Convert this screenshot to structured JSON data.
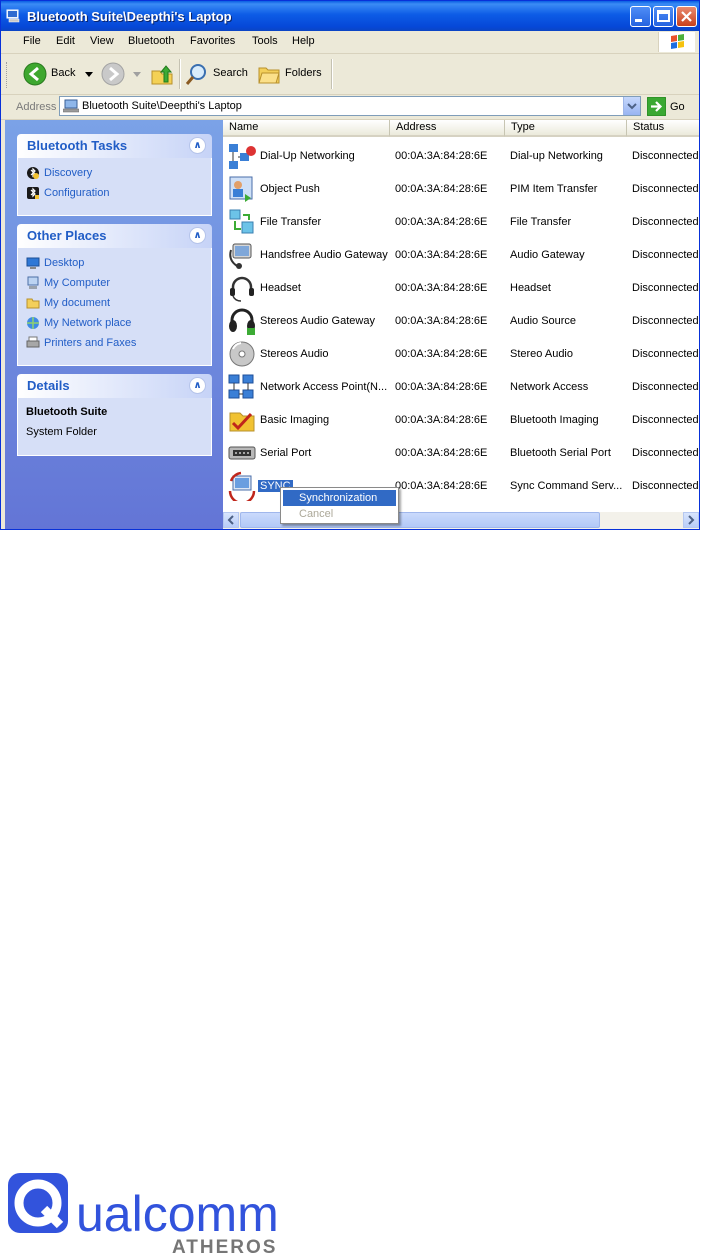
{
  "window": {
    "title": "Bluetooth Suite\\Deepthi's Laptop"
  },
  "menu": [
    "File",
    "Edit",
    "View",
    "Bluetooth",
    "Favorites",
    "Tools",
    "Help"
  ],
  "toolbar": {
    "back": "Back",
    "search": "Search",
    "folders": "Folders"
  },
  "address": {
    "label": "Address",
    "value": "Bluetooth Suite\\Deepthi's Laptop",
    "go": "Go"
  },
  "taskpane": {
    "bluetooth_tasks": {
      "title": "Bluetooth Tasks",
      "items": [
        "Discovery",
        "Configuration"
      ]
    },
    "other_places": {
      "title": "Other Places",
      "items": [
        "Desktop",
        "My Computer",
        "My document",
        "My Network place",
        "Printers and Faxes"
      ]
    },
    "details": {
      "title": "Details",
      "name": "Bluetooth Suite",
      "type": "System Folder"
    }
  },
  "columns": [
    "Name",
    "Address",
    "Type",
    "Status"
  ],
  "rows": [
    {
      "name": "Dial-Up Networking",
      "address": "00:0A:3A:84:28:6E",
      "type": "Dial-up Networking",
      "status": "Disconnected"
    },
    {
      "name": "Object Push",
      "address": "00:0A:3A:84:28:6E",
      "type": "PIM Item Transfer",
      "status": "Disconnected"
    },
    {
      "name": "File Transfer",
      "address": "00:0A:3A:84:28:6E",
      "type": "File Transfer",
      "status": "Disconnected"
    },
    {
      "name": "Handsfree Audio Gateway",
      "address": "00:0A:3A:84:28:6E",
      "type": "Audio Gateway",
      "status": "Disconnected"
    },
    {
      "name": "Headset",
      "address": "00:0A:3A:84:28:6E",
      "type": "Headset",
      "status": "Disconnected"
    },
    {
      "name": "Stereos Audio Gateway",
      "address": "00:0A:3A:84:28:6E",
      "type": "Audio Source",
      "status": "Disconnected"
    },
    {
      "name": "Stereos Audio",
      "address": "00:0A:3A:84:28:6E",
      "type": "Stereo Audio",
      "status": "Disconnected"
    },
    {
      "name": "Network Access Point(N...",
      "address": "00:0A:3A:84:28:6E",
      "type": "Network Access",
      "status": "Disconnected"
    },
    {
      "name": "Basic Imaging",
      "address": "00:0A:3A:84:28:6E",
      "type": "Bluetooth Imaging",
      "status": "Disconnected"
    },
    {
      "name": "Serial Port",
      "address": "00:0A:3A:84:28:6E",
      "type": "Bluetooth Serial Port",
      "status": "Disconnected"
    },
    {
      "name": "SYNC",
      "address": "00:0A:3A:84:28:6E",
      "type": "Sync Command Serv...",
      "status": "Disconnected"
    }
  ],
  "context_menu": {
    "items": [
      "Synchronization",
      "Cancel"
    ]
  },
  "logo": {
    "wordmark": "Qualcomm",
    "sub": "ATHEROS",
    "color": "#3253DC"
  },
  "colors": {
    "titlebar": "#0a5fe3",
    "taskpane": "#7ba2e7",
    "selection": "#316ac5"
  }
}
